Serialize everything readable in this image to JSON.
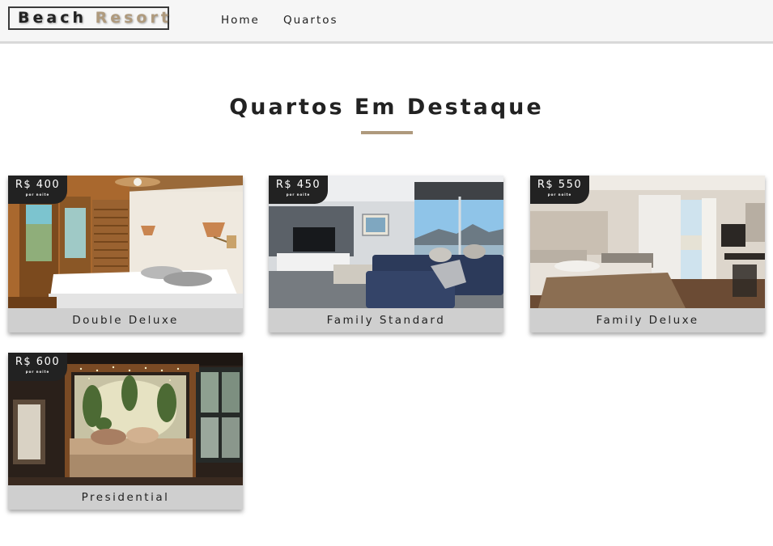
{
  "brand": {
    "part1": "Beach",
    "part2": "Resort"
  },
  "nav": {
    "items": [
      "Home",
      "Quartos"
    ]
  },
  "featured": {
    "title": "Quartos Em Destaque"
  },
  "rooms": [
    {
      "name": "Double Deluxe",
      "price": "R$ 400",
      "unit": "por noite"
    },
    {
      "name": "Family Standard",
      "price": "R$ 450",
      "unit": "por noite"
    },
    {
      "name": "Family Deluxe",
      "price": "R$ 550",
      "unit": "por noite"
    },
    {
      "name": "Presidential",
      "price": "R$ 600",
      "unit": "por noite"
    }
  ],
  "colors": {
    "accent": "#af9a7d",
    "badge": "#222222",
    "card_footer": "#cfcfcf",
    "navbar": "#f6f6f6"
  }
}
